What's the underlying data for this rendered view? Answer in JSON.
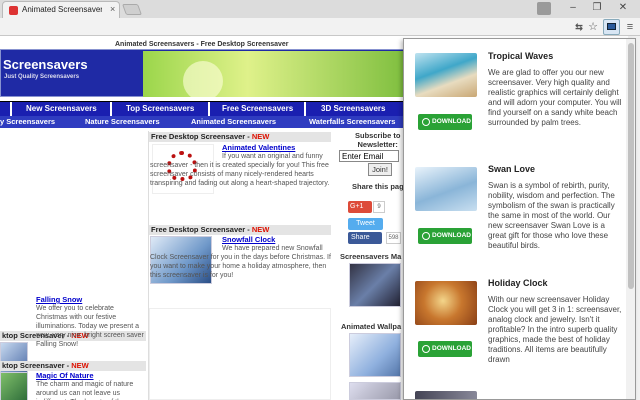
{
  "browser": {
    "tab_title": "Animated Screensavers -",
    "tab_close": "×",
    "window": {
      "minimize": "–",
      "restore": "❐",
      "close": "✕"
    },
    "toolbar_icons": [
      "translate-icon",
      "star-icon",
      "extension-icon",
      "menu-icon"
    ]
  },
  "site": {
    "tagline": "Animated Screensavers - Free Desktop Screensaver",
    "logo": "Screensavers",
    "logo_sub": "Just Quality Screensavers",
    "nav_main": [
      "New Screensavers",
      "Top Screensavers",
      "Free Screensavers",
      "3D Screensavers"
    ],
    "nav_sub": [
      "y Screensavers",
      "Nature Screensavers",
      "Animated Screensavers",
      "Waterfalls Screensavers"
    ],
    "new_badge": "NEW",
    "center_cards": [
      {
        "head": "Free Desktop Screensaver - ",
        "title": "Animated Valentines",
        "text": "If you want an original and funny screensaver - then it is created specially for you! This free screensaver consists of many nicely-rendered hearts transpiring and fading out along a heart-shaped trajectory."
      },
      {
        "head": "Free Desktop Screensaver - ",
        "title": "Snowfall Clock",
        "text": "We have prepared new Snowfall Clock Screensaver for you in the days before Christmas. If you want to make your home a holiday atmosphere, then this screensaver is for you!"
      }
    ],
    "left_cards": [
      {
        "head": "ktop Screensaver - ",
        "title": "Falling Snow",
        "text": "We offer you to celebrate Christmas with our festive illuminations. Today we present a new, very nice, bright screen saver Falling Snow!"
      },
      {
        "head": "ktop Screensaver - ",
        "title": "Magic Of Nature",
        "text": "The charm and magic of nature around us can not leave us indifferent. The beauty of the"
      }
    ],
    "subscribe_label": "Subscribe to\nNewsletter:",
    "email_value": "Enter Email",
    "join_label": "Join!",
    "share_label": "Share this pag",
    "gplus_label": "G+1",
    "gplus_count": "9",
    "tweet_label": "Tweet",
    "fb_label": "Share",
    "fb_count": "598",
    "mac_label": "Screensavers Ma",
    "wall_label": "Animated Wallpa"
  },
  "popup": {
    "download_label": "DOWNLOAD",
    "items": [
      {
        "title": "Tropical Waves",
        "text": "We are glad to offer you our new screensaver. Very high quality and realistic graphics will certainly delight and will adorn your computer. You will find yourself on a sandy white beach surrounded by palm trees."
      },
      {
        "title": "Swan Love",
        "text": "Swan is a symbol of rebirth, purity, nobility, wisdom and perfection. The symbolism of the swan is practically the same in most of the world. Our new screensaver Swan Love is a great gift for those who love these beautiful birds."
      },
      {
        "title": "Holiday Clock",
        "text": "With our new screensaver Holiday Clock you will get 3 in 1: screensaver, analog clock and jewelry. Isn't it profitable? In the intro superb quality graphics, made the best of holiday traditions. All items are beautifully drawn"
      }
    ]
  },
  "colors": {
    "nav_blue": "#1a1fb0",
    "download_green": "#2aa236",
    "new_red": "#d10"
  }
}
